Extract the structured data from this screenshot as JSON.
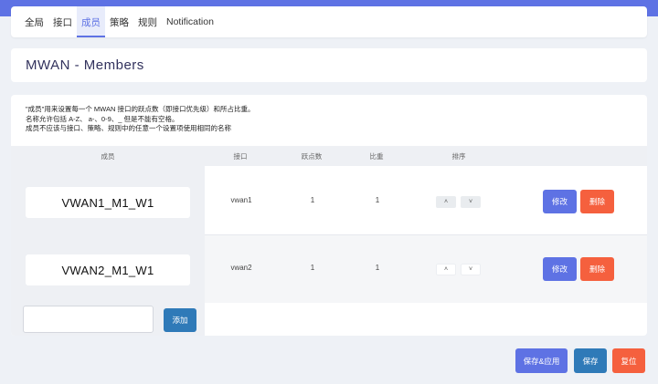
{
  "tabs": [
    "全局",
    "接口",
    "成员",
    "策略",
    "规则",
    "Notification"
  ],
  "active_tab": 2,
  "page_title": "MWAN - Members",
  "description": [
    "\"成员\"用来设置每一个 MWAN 接口的跃点数（即接口优先级）和所占比重。",
    "名称允许包括 A-Z、 a-、0-9、_ 但是不能有空格。",
    "成员不应该与接口、策略、规则中的任意一个设置项使用相同的名称"
  ],
  "table": {
    "headers": {
      "member": "成员",
      "interface": "接口",
      "metric": "跃点数",
      "weight": "比重",
      "sort": "排序"
    },
    "rows": [
      {
        "name": "VWAN1_M1_W1",
        "interface": "vwan1",
        "metric": "1",
        "weight": "1"
      },
      {
        "name": "VWAN2_M1_W1",
        "interface": "vwan2",
        "metric": "1",
        "weight": "1"
      }
    ],
    "sort_up": "˄",
    "sort_down": "˅",
    "edit_label": "修改",
    "delete_label": "删除"
  },
  "add": {
    "input_value": "",
    "button_label": "添加"
  },
  "footer": {
    "save_apply_label": "保存&应用",
    "save_label": "保存",
    "reset_label": "复位"
  },
  "colors": {
    "accent": "#5e72e4",
    "danger": "#f5603e",
    "primary": "#2f7ab8"
  }
}
